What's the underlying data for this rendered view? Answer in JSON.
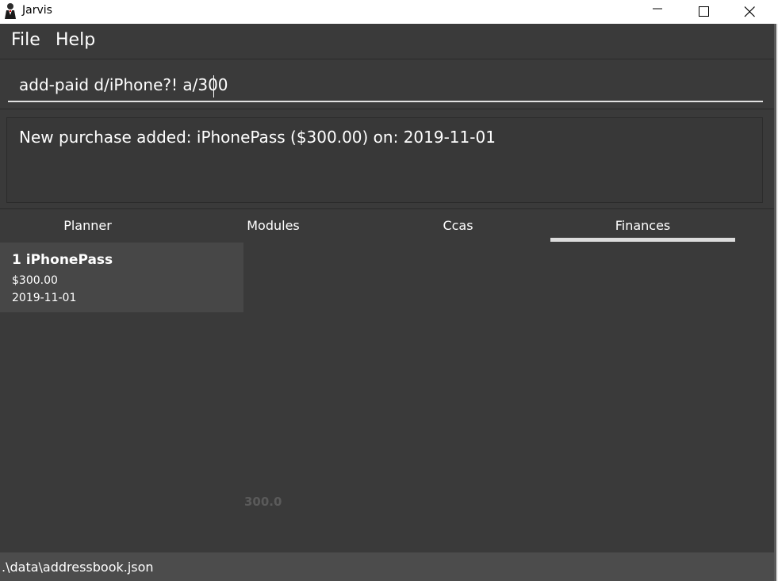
{
  "window": {
    "title": "Jarvis",
    "app_icon": "butler-icon",
    "controls": [
      "minimize-icon",
      "maximize-icon",
      "close-icon"
    ]
  },
  "menu": {
    "file_label": "File",
    "help_label": "Help"
  },
  "command_box": {
    "value": "add-paid d/iPhone?! a/300",
    "placeholder": ""
  },
  "result_display": {
    "text": "New purchase added: iPhonePass ($300.00) on: 2019-11-01"
  },
  "tabs": [
    {
      "label": "Planner",
      "selected": false
    },
    {
      "label": "Modules",
      "selected": false
    },
    {
      "label": "Ccas",
      "selected": false
    },
    {
      "label": "Finances",
      "selected": true
    }
  ],
  "finances": {
    "purchases": [
      {
        "title": "1 iPhonePass",
        "amount": "$300.00",
        "date": "2019-11-01"
      }
    ],
    "chart_value_label": "300.0"
  },
  "status_bar": {
    "path": ".\\data\\addressbook.json"
  },
  "colors": {
    "background": "#383838",
    "panel": "#3a3a3a",
    "card": "#474747",
    "status_bar": "#4c4c4c",
    "tab_underline": "#dcdcdc"
  }
}
